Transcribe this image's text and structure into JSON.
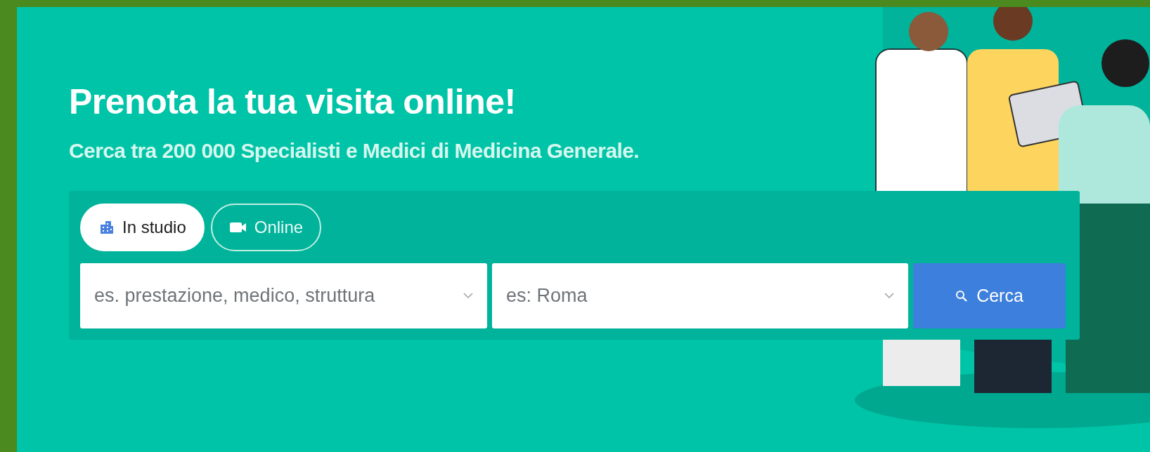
{
  "hero": {
    "title": "Prenota la tua visita online!",
    "subtitle": "Cerca tra 200 000 Specialisti e Medici di Medicina Generale."
  },
  "search": {
    "tabs": [
      {
        "label": "In studio",
        "kind": "building",
        "selected": true
      },
      {
        "label": "Online",
        "kind": "video",
        "selected": false
      }
    ],
    "fields": [
      {
        "placeholder": "es. prestazione, medico, struttura"
      },
      {
        "placeholder": "es: Roma"
      }
    ],
    "button": "Cerca"
  }
}
